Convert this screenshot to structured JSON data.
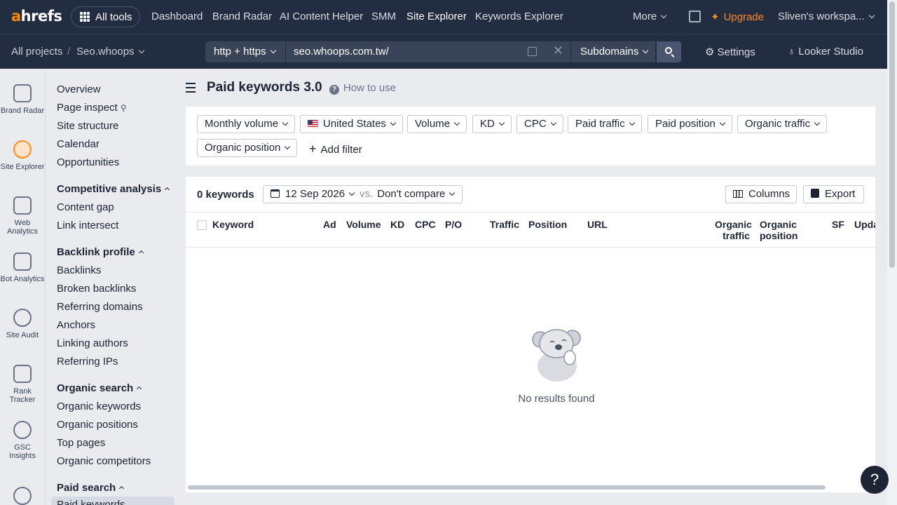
{
  "brand": {
    "logo_a": "a",
    "logo_rest": "hrefs",
    "accent": "#ff8800"
  },
  "topnav": {
    "all_tools": "All tools",
    "links": [
      "Dashboard",
      "Brand Radar",
      "AI Content Helper",
      "SMM",
      "Site Explorer",
      "Keywords Explorer"
    ],
    "active": "Site Explorer",
    "more": "More",
    "upgrade": "Upgrade",
    "workspace": "Sliven's workspa..."
  },
  "subbar": {
    "all_projects": "All projects",
    "separator": "/",
    "project": "Seo.whoops",
    "protocol": "http + https",
    "url_value": "seo.whoops.com.tw/",
    "scope": "Subdomains",
    "settings": "Settings",
    "looker": "Looker Studio"
  },
  "rail": [
    {
      "label": "Brand Radar",
      "icon": "brand-radar-icon"
    },
    {
      "label": "Site Explorer",
      "icon": "site-explorer-icon",
      "active": true
    },
    {
      "label": "Web Analytics",
      "icon": "web-analytics-icon"
    },
    {
      "label": "Bot Analytics",
      "icon": "bot-analytics-icon"
    },
    {
      "label": "Site Audit",
      "icon": "site-audit-icon"
    },
    {
      "label": "Rank Tracker",
      "icon": "rank-tracker-icon"
    },
    {
      "label": "GSC Insights",
      "icon": "gsc-insights-icon"
    }
  ],
  "sidebar": {
    "top": [
      "Overview",
      "Page inspect",
      "Site structure",
      "Calendar",
      "Opportunities"
    ],
    "competitive_head": "Competitive analysis",
    "competitive": [
      "Content gap",
      "Link intersect"
    ],
    "backlink_head": "Backlink profile",
    "backlink": [
      "Backlinks",
      "Broken backlinks",
      "Referring domains",
      "Anchors",
      "Linking authors",
      "Referring IPs"
    ],
    "organic_head": "Organic search",
    "organic": [
      "Organic keywords",
      "Organic positions",
      "Top pages",
      "Organic competitors"
    ],
    "paid_head": "Paid search",
    "paid_first": "Paid keywords"
  },
  "main": {
    "title": "Paid keywords 3.0",
    "how_to_use": "How to use",
    "filters": [
      "Monthly volume",
      "United States",
      "Volume",
      "KD",
      "CPC",
      "Paid traffic",
      "Paid position",
      "Organic traffic",
      "Organic position"
    ],
    "add_filter": "Add filter",
    "count": "0 keywords",
    "date": "12 Sep 2026",
    "vs": "vs.",
    "compare": "Don't compare",
    "columns": "Columns",
    "export": "Export",
    "headers": {
      "keyword": "Keyword",
      "ad": "Ad",
      "volume": "Volume",
      "kd": "KD",
      "cpc": "CPC",
      "po": "P/O",
      "traffic": "Traffic",
      "position": "Position",
      "url": "URL",
      "org_traffic_1": "Organic",
      "org_traffic_2": "traffic",
      "org_pos_1": "Organic",
      "org_pos_2": "position",
      "sf": "SF",
      "updated": "Upda"
    },
    "empty": "No results found"
  },
  "help": "?"
}
